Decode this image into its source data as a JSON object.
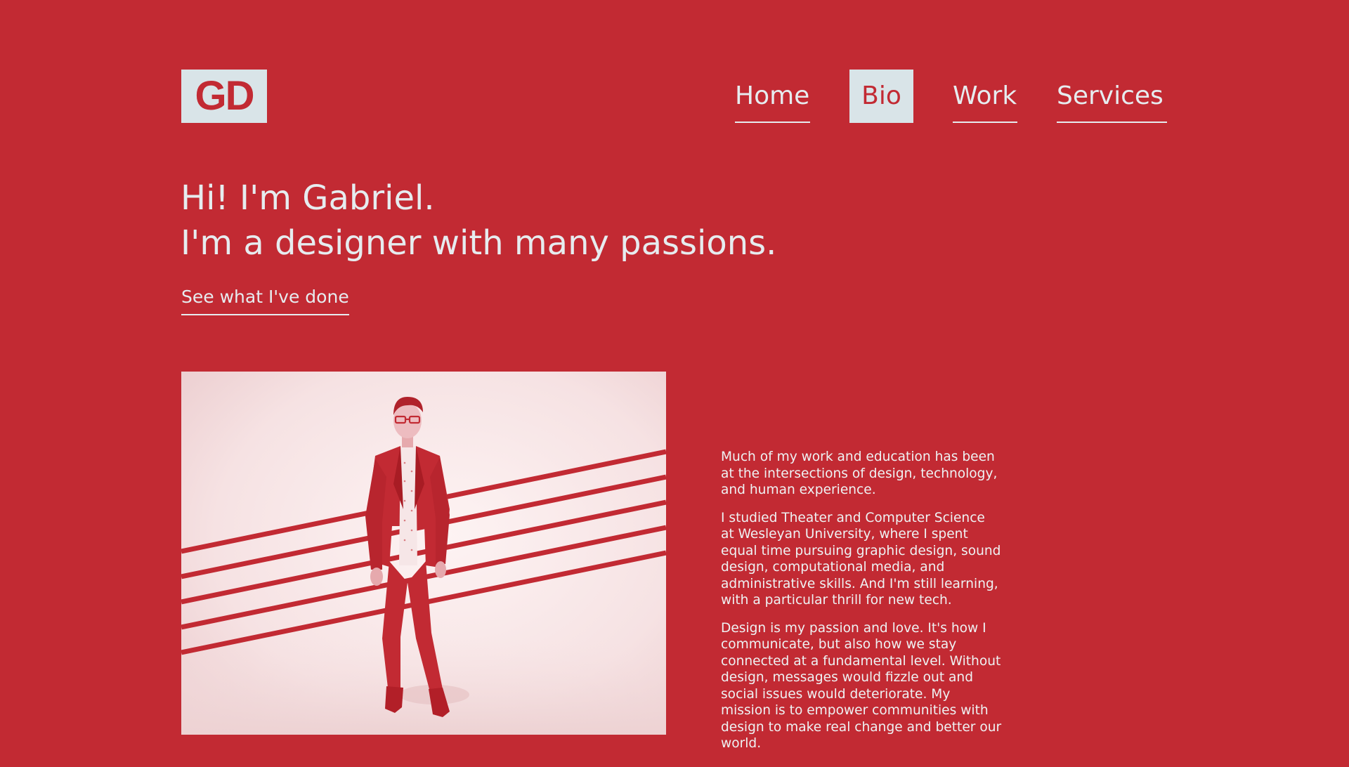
{
  "colors": {
    "background": "#c22a33",
    "text_light": "#e6ecef",
    "active_nav_background": "#d9e4e8"
  },
  "logo": {
    "text": "GD"
  },
  "nav": {
    "items": [
      {
        "label": "Home",
        "active": false
      },
      {
        "label": "Bio",
        "active": true
      },
      {
        "label": "Work",
        "active": false
      },
      {
        "label": "Services",
        "active": false
      }
    ]
  },
  "hero": {
    "line1": "Hi! I'm Gabriel.",
    "line2": "I'm a designer with many passions.",
    "cta_label": "See what I've done"
  },
  "bio": {
    "paragraphs": [
      "Much of my work and education has been at the intersections of design, technology, and human experience.",
      "I studied Theater and Computer Science at Wesleyan University, where I spent equal time pursuing graphic design, sound design, computational media, and administrative skills. And I'm still learning, with a particular thrill for new tech.",
      "Design is my passion and love. It's how I communicate, but also how we stay connected at a fundamental level. Without design, messages would fizzle out and social issues would deteriorate. My mission is to empower communities with design to make real change and better our world."
    ]
  }
}
